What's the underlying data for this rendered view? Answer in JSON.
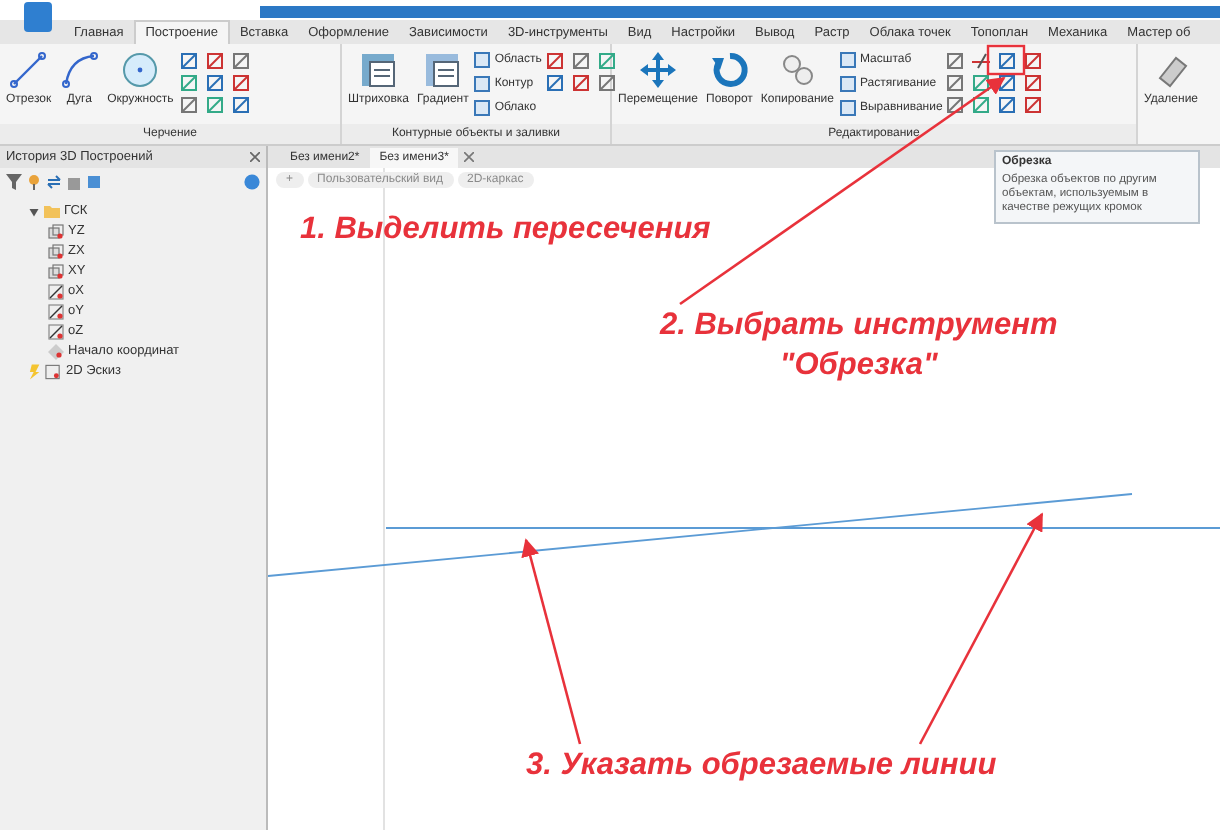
{
  "menu_tabs": [
    {
      "label": "Главная",
      "selected": false
    },
    {
      "label": "Построение",
      "selected": true
    },
    {
      "label": "Вставка",
      "selected": false
    },
    {
      "label": "Оформление",
      "selected": false
    },
    {
      "label": "Зависимости",
      "selected": false
    },
    {
      "label": "3D-инструменты",
      "selected": false
    },
    {
      "label": "Вид",
      "selected": false
    },
    {
      "label": "Настройки",
      "selected": false
    },
    {
      "label": "Вывод",
      "selected": false
    },
    {
      "label": "Растр",
      "selected": false
    },
    {
      "label": "Облака точек",
      "selected": false
    },
    {
      "label": "Топоплан",
      "selected": false
    },
    {
      "label": "Механика",
      "selected": false
    },
    {
      "label": "Мастер об",
      "selected": false
    }
  ],
  "ribbon_groups": [
    {
      "label": "Черчение",
      "big_buttons": [
        "Отрезок",
        "Дуга",
        "Окружность"
      ]
    },
    {
      "label": "Контурные объекты и заливки",
      "big_buttons": [
        "Штриховка",
        "Градиент"
      ],
      "small_buttons": [
        "Область",
        "Контур",
        "Облако"
      ]
    },
    {
      "label": "Редактирование",
      "big_buttons": [
        "Перемещение",
        "Поворот",
        "Копирование"
      ],
      "small_buttons": [
        "Масштаб",
        "Растягивание",
        "Выравнивание"
      ]
    },
    {
      "big_buttons": [
        "Удаление"
      ]
    }
  ],
  "history_panel": {
    "title": "История 3D Построений",
    "tree": [
      {
        "label": "ГСК",
        "kind": "folder",
        "expanded": true,
        "children": [
          {
            "label": "YZ",
            "kind": "plane"
          },
          {
            "label": "ZX",
            "kind": "plane"
          },
          {
            "label": "XY",
            "kind": "plane"
          },
          {
            "label": "oX",
            "kind": "axis"
          },
          {
            "label": "oY",
            "kind": "axis"
          },
          {
            "label": "oZ",
            "kind": "axis"
          },
          {
            "label": "Начало координат",
            "kind": "point"
          }
        ]
      },
      {
        "label": "2D Эскиз",
        "kind": "sketch"
      }
    ]
  },
  "doc_tabs": [
    {
      "label": "Без имени2*",
      "selected": false
    },
    {
      "label": "Без имени3*",
      "selected": true
    }
  ],
  "view_chips": [
    "+",
    "Пользовательский вид",
    "2D-каркас"
  ],
  "tooltip": {
    "title": "Обрезка",
    "text": "Обрезка объектов по другим объектам, используемым в качестве режущих кромок"
  },
  "annotations": [
    {
      "lines": [
        "1. Выделить пересечения"
      ]
    },
    {
      "lines": [
        "2. Выбрать инструмент",
        "\"Обрезка\""
      ]
    },
    {
      "lines": [
        "3. Указать обрезаемые линии"
      ]
    }
  ]
}
